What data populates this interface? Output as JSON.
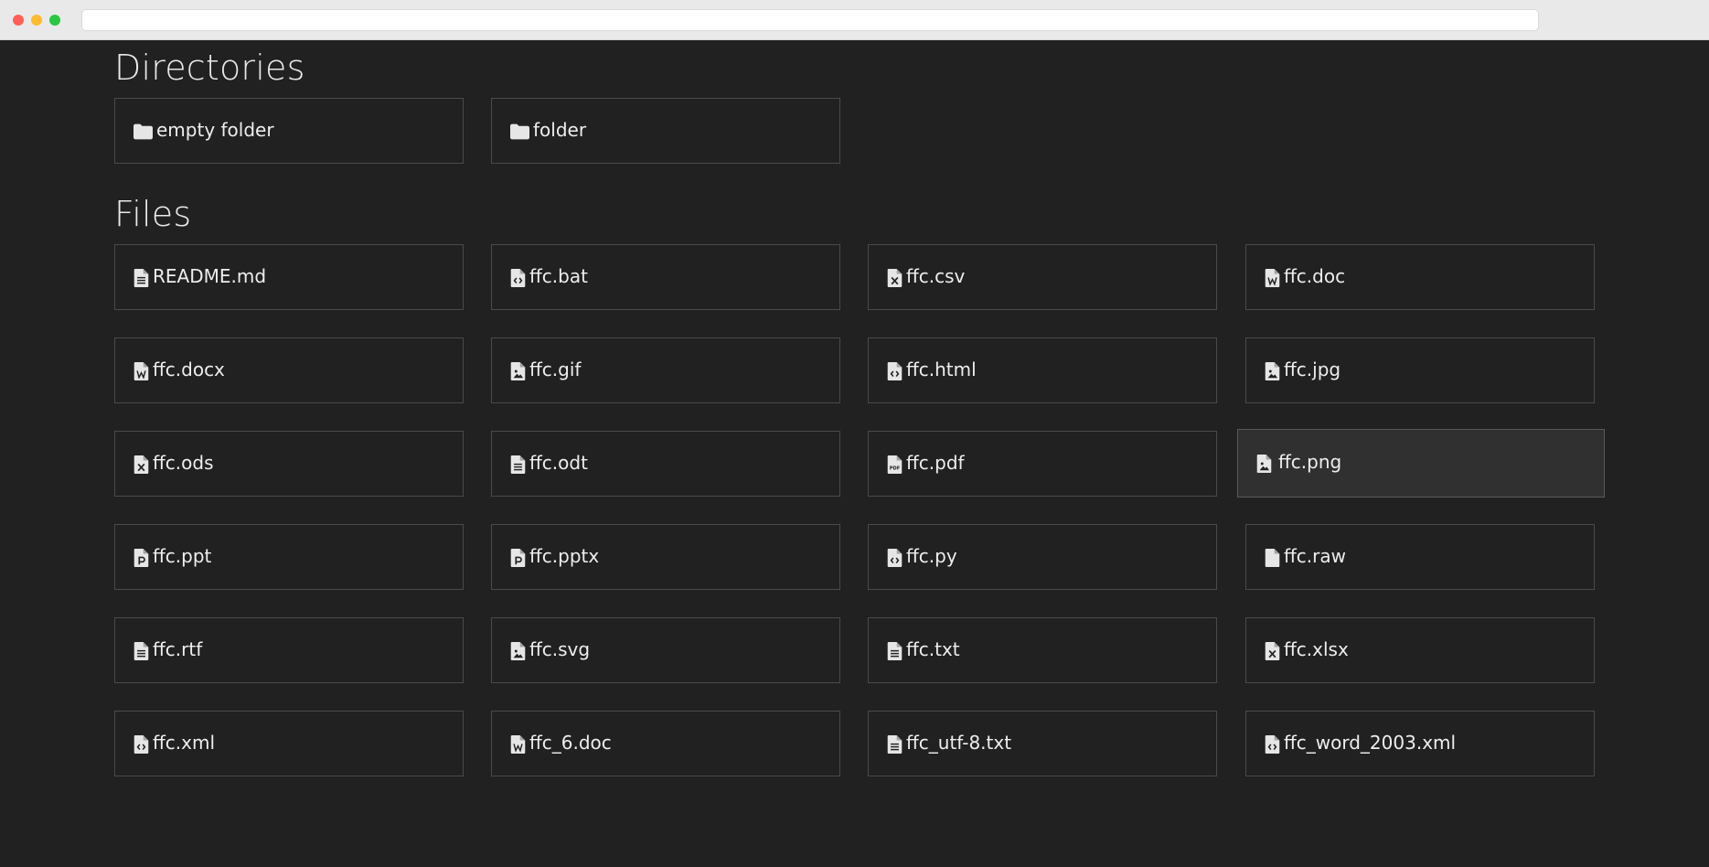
{
  "browser": {
    "url": ""
  },
  "sections": {
    "directories_title": "Directories",
    "files_title": "Files"
  },
  "directories": [
    {
      "name": "empty folder",
      "icon": "folder-icon"
    },
    {
      "name": "folder",
      "icon": "folder-icon"
    }
  ],
  "files": [
    {
      "name": "README.md",
      "icon": "file-text-icon"
    },
    {
      "name": "ffc.bat",
      "icon": "file-code-icon"
    },
    {
      "name": "ffc.csv",
      "icon": "file-excel-icon"
    },
    {
      "name": "ffc.doc",
      "icon": "file-word-icon"
    },
    {
      "name": "ffc.docx",
      "icon": "file-word-icon"
    },
    {
      "name": "ffc.gif",
      "icon": "file-image-icon"
    },
    {
      "name": "ffc.html",
      "icon": "file-code-icon"
    },
    {
      "name": "ffc.jpg",
      "icon": "file-image-icon"
    },
    {
      "name": "ffc.ods",
      "icon": "file-excel-icon"
    },
    {
      "name": "ffc.odt",
      "icon": "file-text-icon"
    },
    {
      "name": "ffc.pdf",
      "icon": "file-pdf-icon"
    },
    {
      "name": "ffc.png",
      "icon": "file-image-icon",
      "hovered": true
    },
    {
      "name": "ffc.ppt",
      "icon": "file-powerpoint-icon"
    },
    {
      "name": "ffc.pptx",
      "icon": "file-powerpoint-icon"
    },
    {
      "name": "ffc.py",
      "icon": "file-code-icon"
    },
    {
      "name": "ffc.raw",
      "icon": "file-blank-icon"
    },
    {
      "name": "ffc.rtf",
      "icon": "file-text-icon"
    },
    {
      "name": "ffc.svg",
      "icon": "file-image-icon"
    },
    {
      "name": "ffc.txt",
      "icon": "file-text-icon"
    },
    {
      "name": "ffc.xlsx",
      "icon": "file-excel-icon"
    },
    {
      "name": "ffc.xml",
      "icon": "file-code-icon"
    },
    {
      "name": "ffc_6.doc",
      "icon": "file-word-icon"
    },
    {
      "name": "ffc_utf-8.txt",
      "icon": "file-text-icon"
    },
    {
      "name": "ffc_word_2003.xml",
      "icon": "file-code-icon"
    }
  ],
  "colors": {
    "background": "#212121",
    "card_border": "#4a4a4a",
    "card_hover_bg": "#303030",
    "text": "#eeeeee",
    "icon": "#e6e6e6"
  }
}
